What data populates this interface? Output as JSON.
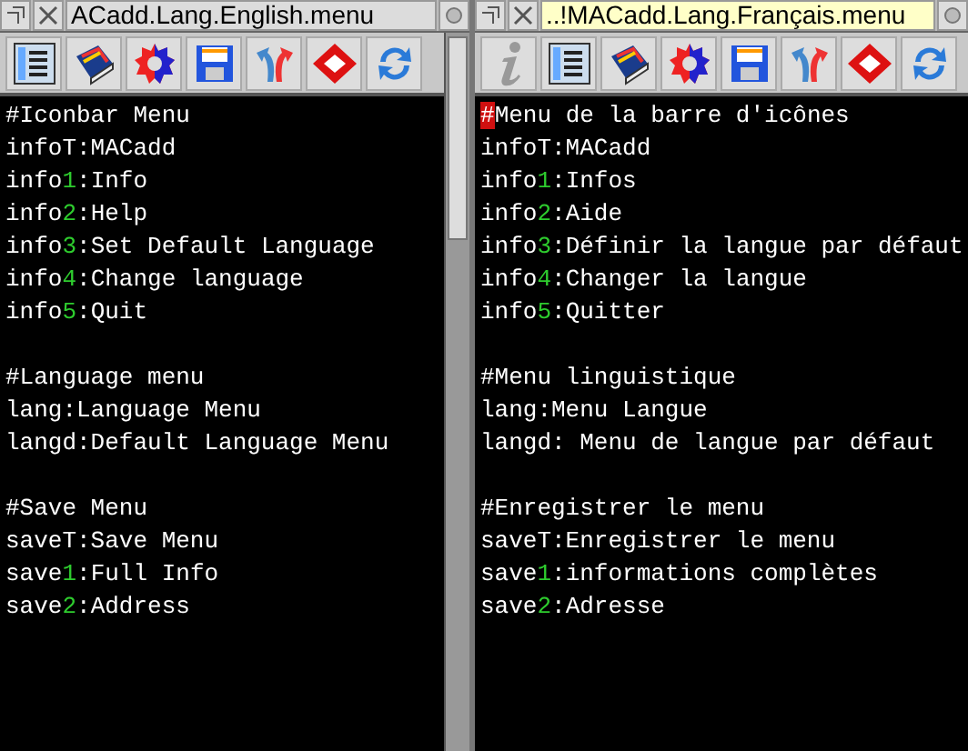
{
  "windows": [
    {
      "title": "ACadd.Lang.English.menu",
      "focused": false,
      "info_button": false,
      "scrollbar": true,
      "cursor": false,
      "lines": [
        {
          "kind": "text",
          "text": "#Iconbar Menu"
        },
        {
          "kind": "text",
          "text": "infoT:MACadd"
        },
        {
          "kind": "text",
          "text": "info",
          "number": "1",
          "rest": ":Info"
        },
        {
          "kind": "text",
          "text": "info",
          "number": "2",
          "rest": ":Help"
        },
        {
          "kind": "text",
          "text": "info",
          "number": "3",
          "rest": ":Set Default Language"
        },
        {
          "kind": "text",
          "text": "info",
          "number": "4",
          "rest": ":Change language"
        },
        {
          "kind": "text",
          "text": "info",
          "number": "5",
          "rest": ":Quit"
        },
        {
          "kind": "blank"
        },
        {
          "kind": "text",
          "text": "#Language menu"
        },
        {
          "kind": "text",
          "text": "lang:Language Menu"
        },
        {
          "kind": "text",
          "text": "langd:Default Language Menu"
        },
        {
          "kind": "blank"
        },
        {
          "kind": "text",
          "text": "#Save Menu"
        },
        {
          "kind": "text",
          "text": "saveT:Save Menu"
        },
        {
          "kind": "text",
          "text": "save",
          "number": "1",
          "rest": ":Full Info"
        },
        {
          "kind": "text",
          "text": "save",
          "number": "2",
          "rest": ":Address"
        }
      ]
    },
    {
      "title": "..!MACadd.Lang.Français.menu",
      "focused": true,
      "info_button": true,
      "scrollbar": false,
      "cursor": true,
      "lines": [
        {
          "kind": "text",
          "text": "#Menu de la barre d'icônes"
        },
        {
          "kind": "text",
          "text": "infoT:MACadd"
        },
        {
          "kind": "text",
          "text": "info",
          "number": "1",
          "rest": ":Infos"
        },
        {
          "kind": "text",
          "text": "info",
          "number": "2",
          "rest": ":Aide"
        },
        {
          "kind": "text",
          "text": "info",
          "number": "3",
          "rest": ":Définir la langue par défaut"
        },
        {
          "kind": "text",
          "text": "info",
          "number": "4",
          "rest": ":Changer la langue"
        },
        {
          "kind": "text",
          "text": "info",
          "number": "5",
          "rest": ":Quitter"
        },
        {
          "kind": "blank"
        },
        {
          "kind": "text",
          "text": "#Menu linguistique"
        },
        {
          "kind": "text",
          "text": "lang:Menu Langue"
        },
        {
          "kind": "text",
          "text": "langd: Menu de langue par défaut"
        },
        {
          "kind": "blank"
        },
        {
          "kind": "text",
          "text": "#Enregistrer le menu"
        },
        {
          "kind": "text",
          "text": "saveT:Enregistrer le menu"
        },
        {
          "kind": "text",
          "text": "save",
          "number": "1",
          "rest": ":informations complètes"
        },
        {
          "kind": "text",
          "text": "save",
          "number": "2",
          "rest": ":Adresse"
        }
      ]
    }
  ]
}
